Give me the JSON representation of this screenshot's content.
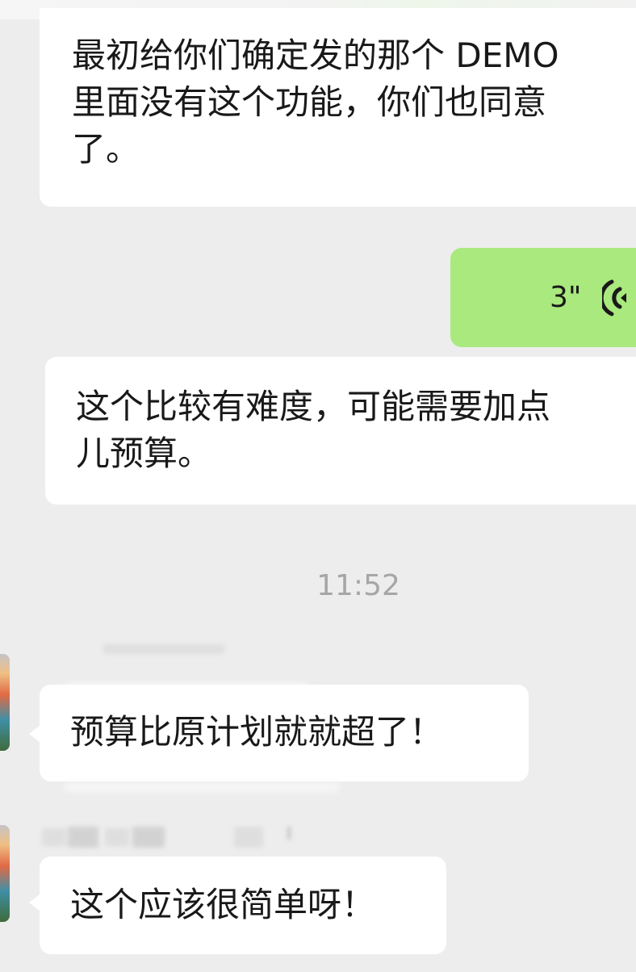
{
  "messages": [
    {
      "side": "left",
      "lines": [
        "最初给你们确定发的那个 DEMO",
        "里面没有这个功能，你们也同意",
        "了。"
      ]
    },
    {
      "side": "right",
      "type": "voice",
      "duration": "3\"",
      "icon": "voice-wave-icon"
    },
    {
      "side": "left",
      "lines": [
        "这个比较有难度，可能需要加点",
        "儿预算。"
      ]
    }
  ],
  "timestamp": "11:52",
  "group_messages": [
    {
      "avatar": "avatar-landscape",
      "text": "预算比原计划就就超了！"
    },
    {
      "avatar": "avatar-landscape",
      "text": "这个应该很简单呀！"
    }
  ],
  "colors": {
    "background": "#ededed",
    "incoming_bubble": "#ffffff",
    "outgoing_bubble": "#a9e97d",
    "timestamp": "#a6a6a6",
    "text": "#191919"
  }
}
